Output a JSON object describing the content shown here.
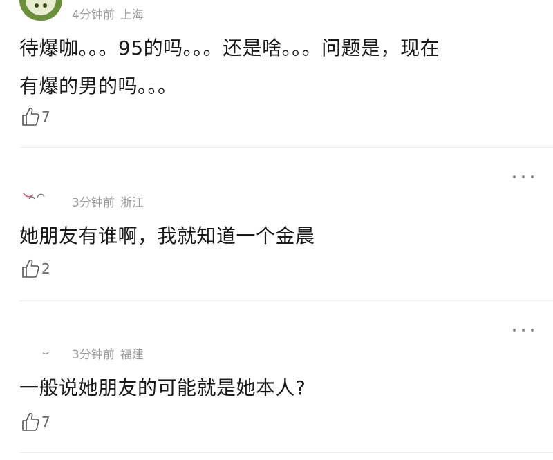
{
  "comments": [
    {
      "time": "4分钟前",
      "location": "上海",
      "text_line1": "待爆咖。。。95的吗。。。还是啥。。。问题是，现在",
      "text_line2": "有爆的男的吗。。。",
      "likes": "7",
      "like_icon": "thumbs-up-icon"
    },
    {
      "time": "3分钟前",
      "location": "浙江",
      "text_line1": "她朋友有谁啊，我就知道一个金晨",
      "likes": "2",
      "like_icon": "thumbs-up-icon",
      "more_icon": "more-dots-icon"
    },
    {
      "time": "3分钟前",
      "location": "福建",
      "text_line1": "一般说她朋友的可能就是她本人?",
      "likes": "7",
      "like_icon": "thumbs-up-icon",
      "more_icon": "more-dots-icon"
    }
  ]
}
